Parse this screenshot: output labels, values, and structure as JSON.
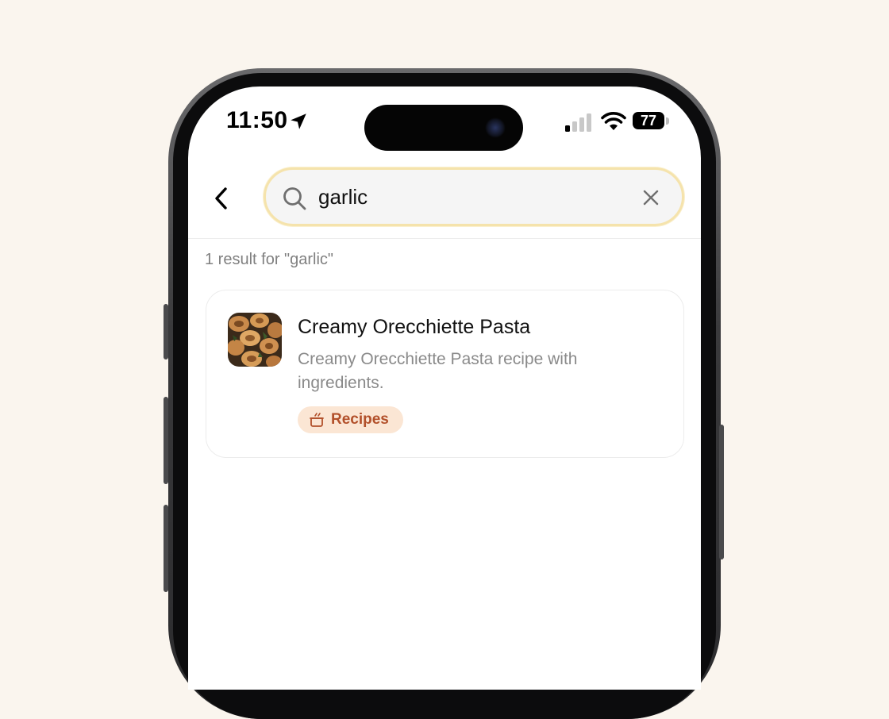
{
  "status_bar": {
    "time": "11:50",
    "battery_level": "77",
    "icons": [
      "location-arrow-icon",
      "cellular-signal-icon",
      "wifi-icon",
      "battery-icon"
    ]
  },
  "search": {
    "query": "garlic",
    "icons": [
      "back-chevron-icon",
      "search-icon",
      "clear-x-icon"
    ]
  },
  "results": {
    "count_text": "1 result for \"garlic\"",
    "items": [
      {
        "title": "Creamy Orecchiette Pasta",
        "description": "Creamy Orecchiette Pasta recipe with ingredients.",
        "category": "Recipes",
        "category_icon": "pot-icon",
        "thumbnail": "pasta-photo"
      }
    ]
  },
  "colors": {
    "background": "#faf5ee",
    "search_border": "#f5e3ac",
    "badge_bg": "#fbe6d4",
    "badge_text": "#b2502a"
  }
}
